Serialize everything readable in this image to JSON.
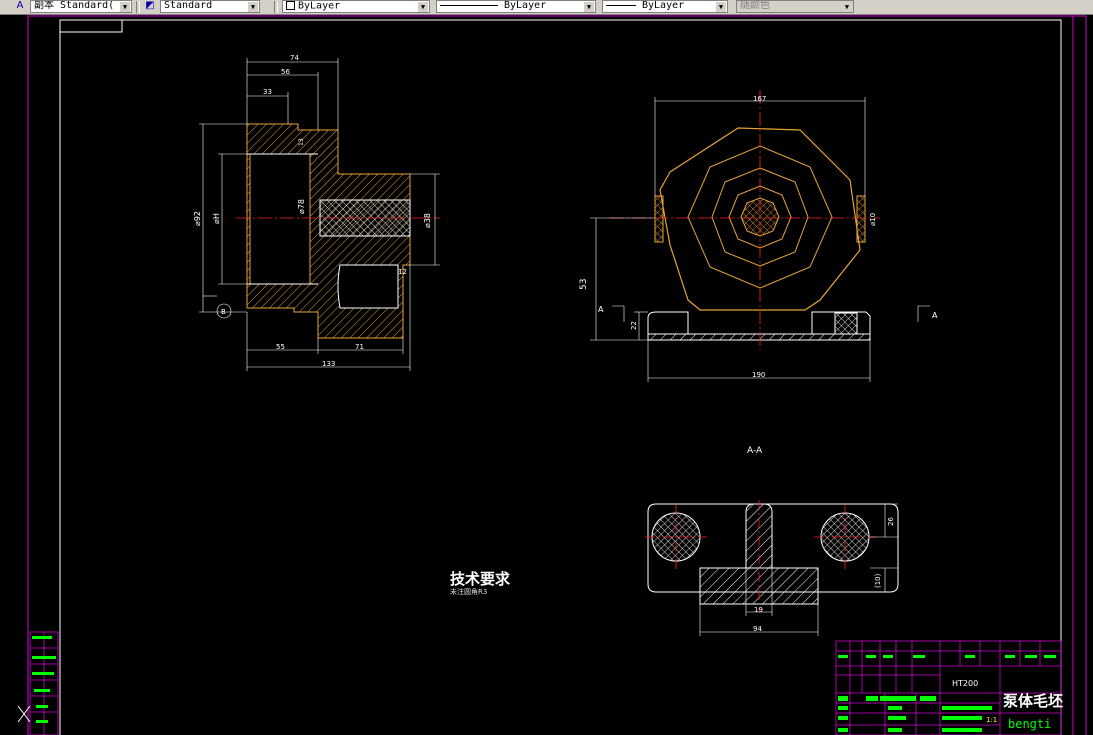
{
  "toolbar": {
    "text_style": "副本 Standard(",
    "dim_style": "Standard",
    "layer": "ByLayer",
    "linetype": "ByLayer",
    "lineweight": "ByLayer",
    "color": "随颜色"
  },
  "drawing": {
    "front_dims": {
      "d74": "74",
      "d56": "56",
      "d33": "33",
      "d92": "⌀92",
      "dH": "⌀H",
      "d78": "⌀78",
      "d38": "⌀38",
      "d12": "12",
      "d55": "55",
      "d71": "71",
      "d133": "133",
      "d13": "13",
      "datum": "B"
    },
    "side_dims": {
      "d167": "167",
      "d53": "53",
      "d22": "22",
      "d190": "190",
      "d10": "⌀10",
      "cut_a": "A"
    },
    "section_title": "A-A",
    "section_dims": {
      "d26": "26",
      "d10": "(10)",
      "d19": "19",
      "d94": "94"
    }
  },
  "tech_req": {
    "title": "技术要求",
    "note": "未注圆角R3"
  },
  "title_block": {
    "name": "泵体毛坯",
    "code": "bengti",
    "material": "HT200",
    "scale": "1:1"
  }
}
